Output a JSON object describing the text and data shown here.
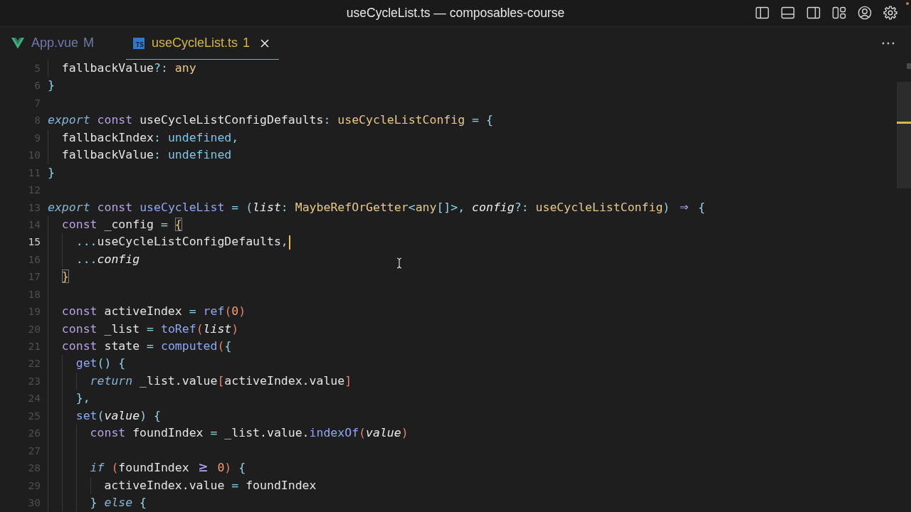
{
  "window": {
    "title": "useCycleList.ts — composables-course"
  },
  "tabs": [
    {
      "label": "App.vue",
      "kind": "vue",
      "badge": "M",
      "color": "#7079ab",
      "selected": false
    },
    {
      "label": "useCycleList.ts",
      "kind": "ts",
      "icon_label": "TS",
      "badge": "1",
      "color": "#d4b445",
      "selected": true
    }
  ],
  "editor": {
    "lines": [
      {
        "children": [
          {
            "number": "5",
            "current": false,
            "tokens": [
              {
                "text": "fallbackValue",
                "kind": "plain"
              },
              {
                "text": "?: ",
                "kind": "punct"
              },
              {
                "text": "any",
                "kind": "type"
              }
            ]
          }
        ]
      },
      {
        "number": "6",
        "current": false,
        "tokens": [
          {
            "text": "}",
            "kind": "punct"
          }
        ]
      },
      {
        "number": "7",
        "current": false
      },
      {
        "number": "8",
        "current": false,
        "tokens": [
          {
            "text": "export",
            "kind": "control"
          },
          {
            "text": " const",
            "kind": "keyword"
          },
          {
            "text": " useCycleListConfigDefaults",
            "kind": "plain"
          },
          {
            "text": ": ",
            "kind": "punct"
          },
          {
            "text": "useCycleListConfig",
            "kind": "type"
          },
          {
            "text": " = {",
            "kind": "punct"
          }
        ],
        "children": [
          {
            "number": "9",
            "current": false,
            "tokens": [
              {
                "text": "fallbackIndex",
                "kind": "plain"
              },
              {
                "text": ": ",
                "kind": "punct"
              },
              {
                "text": "undefined",
                "kind": "constant"
              },
              {
                "text": ",",
                "kind": "punct"
              }
            ]
          },
          {
            "number": "10",
            "current": false,
            "tokens": [
              {
                "text": "fallbackValue",
                "kind": "plain"
              },
              {
                "text": ": ",
                "kind": "punct"
              },
              {
                "text": "undefined",
                "kind": "constant"
              }
            ]
          }
        ]
      },
      {
        "number": "11",
        "current": false,
        "tokens": [
          {
            "text": "}",
            "kind": "punct"
          }
        ]
      },
      {
        "number": "12",
        "current": false
      },
      {
        "number": "13",
        "current": false,
        "tokens": [
          {
            "text": "export",
            "kind": "control"
          },
          {
            "text": " const",
            "kind": "keyword"
          },
          {
            "text": " useCycleList",
            "kind": "func"
          },
          {
            "text": " = (",
            "kind": "punct"
          },
          {
            "text": "list",
            "kind": "param"
          },
          {
            "text": ": ",
            "kind": "punct"
          },
          {
            "text": "MaybeRefOrGetter",
            "kind": "type"
          },
          {
            "text": "<",
            "kind": "punct"
          },
          {
            "text": "any",
            "kind": "type"
          },
          {
            "text": "[]>, ",
            "kind": "punct"
          },
          {
            "text": "config",
            "kind": "param"
          },
          {
            "text": "?: ",
            "kind": "punct"
          },
          {
            "text": "useCycleListConfig",
            "kind": "type"
          },
          {
            "text": ") ",
            "kind": "punct"
          },
          {
            "text": "⇒",
            "kind": "ligature"
          },
          {
            "text": " {",
            "kind": "punct"
          }
        ],
        "children": [
          {
            "number": "14",
            "current": false,
            "tokens": [
              {
                "text": "const",
                "kind": "keyword"
              },
              {
                "text": " _config",
                "kind": "plain"
              },
              {
                "text": " = ",
                "kind": "punct"
              },
              {
                "text": "{",
                "kind": "match"
              }
            ],
            "children": [
              {
                "number": "15",
                "current": true,
                "tokens": [
                  {
                    "text": "...",
                    "kind": "punct"
                  },
                  {
                    "text": "useCycleListConfigDefaults",
                    "kind": "plain"
                  },
                  {
                    "text": ",",
                    "kind": "punct"
                  }
                ]
              },
              {
                "number": "16",
                "current": false,
                "tokens": [
                  {
                    "text": "...",
                    "kind": "punct"
                  },
                  {
                    "text": "config",
                    "kind": "param"
                  }
                ]
              }
            ]
          },
          {
            "number": "17",
            "current": false,
            "tokens": [
              {
                "text": "}",
                "kind": "match"
              }
            ]
          },
          {
            "number": "18",
            "current": false
          },
          {
            "number": "19",
            "current": false,
            "tokens": [
              {
                "text": "const",
                "kind": "keyword"
              },
              {
                "text": " activeIndex",
                "kind": "plain"
              },
              {
                "text": " = ",
                "kind": "punct"
              },
              {
                "text": "ref",
                "kind": "func"
              },
              {
                "text": "(",
                "kind": "bracket"
              },
              {
                "text": "0",
                "kind": "number"
              },
              {
                "text": ")",
                "kind": "bracket"
              }
            ]
          },
          {
            "number": "20",
            "current": false,
            "tokens": [
              {
                "text": "const",
                "kind": "keyword"
              },
              {
                "text": " _list",
                "kind": "plain"
              },
              {
                "text": " = ",
                "kind": "punct"
              },
              {
                "text": "toRef",
                "kind": "func"
              },
              {
                "text": "(",
                "kind": "bracket"
              },
              {
                "text": "list",
                "kind": "param"
              },
              {
                "text": ")",
                "kind": "bracket"
              }
            ]
          },
          {
            "number": "21",
            "current": false,
            "tokens": [
              {
                "text": "const",
                "kind": "keyword"
              },
              {
                "text": " state",
                "kind": "plain"
              },
              {
                "text": " = ",
                "kind": "punct"
              },
              {
                "text": "computed",
                "kind": "func"
              },
              {
                "text": "(",
                "kind": "bracket"
              },
              {
                "text": "{",
                "kind": "punct"
              }
            ],
            "children": [
              {
                "number": "22",
                "current": false,
                "tokens": [
                  {
                    "text": "get",
                    "kind": "func"
                  },
                  {
                    "text": "() {",
                    "kind": "punct"
                  }
                ],
                "children": [
                  {
                    "number": "23",
                    "current": false,
                    "tokens": [
                      {
                        "text": "return",
                        "kind": "control"
                      },
                      {
                        "text": " _list.value",
                        "kind": "plain"
                      },
                      {
                        "text": "[",
                        "kind": "bracket"
                      },
                      {
                        "text": "activeIndex.value",
                        "kind": "plain"
                      },
                      {
                        "text": "]",
                        "kind": "bracket"
                      }
                    ]
                  }
                ]
              },
              {
                "number": "24",
                "current": false,
                "tokens": [
                  {
                    "text": "},",
                    "kind": "punct"
                  }
                ]
              },
              {
                "number": "25",
                "current": false,
                "tokens": [
                  {
                    "text": "set",
                    "kind": "func"
                  },
                  {
                    "text": "(",
                    "kind": "punct"
                  },
                  {
                    "text": "value",
                    "kind": "param"
                  },
                  {
                    "text": ") {",
                    "kind": "punct"
                  }
                ],
                "children": [
                  {
                    "number": "26",
                    "current": false,
                    "tokens": [
                      {
                        "text": "const",
                        "kind": "keyword"
                      },
                      {
                        "text": " foundIndex",
                        "kind": "plain"
                      },
                      {
                        "text": " = ",
                        "kind": "punct"
                      },
                      {
                        "text": "_list.value.",
                        "kind": "plain"
                      },
                      {
                        "text": "indexOf",
                        "kind": "func"
                      },
                      {
                        "text": "(",
                        "kind": "bracket"
                      },
                      {
                        "text": "value",
                        "kind": "param"
                      },
                      {
                        "text": ")",
                        "kind": "bracket"
                      }
                    ]
                  },
                  {
                    "number": "27",
                    "current": false
                  },
                  {
                    "number": "28",
                    "current": false,
                    "tokens": [
                      {
                        "text": "if",
                        "kind": "control"
                      },
                      {
                        "text": " (",
                        "kind": "bracket"
                      },
                      {
                        "text": "foundIndex ",
                        "kind": "plain"
                      },
                      {
                        "text": "≥",
                        "kind": "ligature"
                      },
                      {
                        "text": " 0",
                        "kind": "number"
                      },
                      {
                        "text": ")",
                        "kind": "bracket"
                      },
                      {
                        "text": " {",
                        "kind": "punct"
                      }
                    ],
                    "children": [
                      {
                        "number": "29",
                        "current": false,
                        "tokens": [
                          {
                            "text": "activeIndex.value",
                            "kind": "plain"
                          },
                          {
                            "text": " = ",
                            "kind": "punct"
                          },
                          {
                            "text": "foundIndex",
                            "kind": "plain"
                          }
                        ]
                      }
                    ]
                  },
                  {
                    "number": "30",
                    "current": false,
                    "tokens": [
                      {
                        "text": "}",
                        "kind": "punct"
                      },
                      {
                        "text": " else",
                        "kind": "control"
                      },
                      {
                        "text": " {",
                        "kind": "punct"
                      }
                    ]
                  }
                ]
              }
            ]
          }
        ]
      }
    ]
  }
}
